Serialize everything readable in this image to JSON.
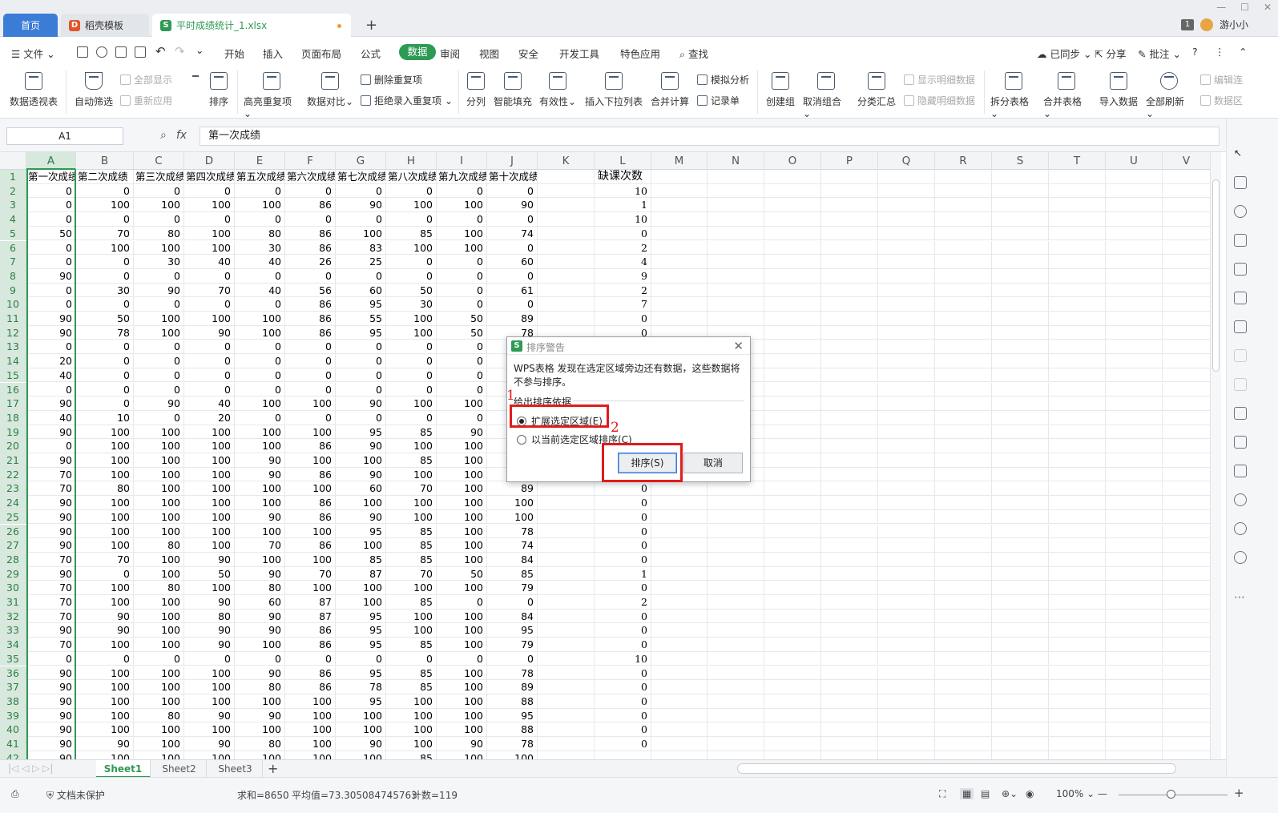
{
  "tabs": {
    "home": "首页",
    "template": "稻壳模板",
    "file": "平时成绩统计_1.xlsx",
    "new": "+"
  },
  "user": {
    "badge": "1",
    "name": "游小小"
  },
  "menu": {
    "file": "文件",
    "items": [
      "开始",
      "插入",
      "页面布局",
      "公式",
      "数据",
      "审阅",
      "视图",
      "安全",
      "开发工具",
      "特色应用"
    ],
    "active": "数据",
    "search": "查找",
    "right": [
      "已同步",
      "分享",
      "批注"
    ]
  },
  "ribbon": {
    "pivot": "数据透视表",
    "autofilter": "自动筛选",
    "show_all": "全部显示",
    "reapply": "重新应用",
    "sort": "排序",
    "highlight_dup": "高亮重复项",
    "compare": "数据对比",
    "delete_dup": "删除重复项",
    "reject_dup": "拒绝录入重复项",
    "split": "分列",
    "smart_fill": "智能填充",
    "validity": "有效性",
    "insert_dropdown": "插入下拉列表",
    "consolidate": "合并计算",
    "simulate": "模拟分析",
    "record": "记录单",
    "create_group": "创建组",
    "ungroup": "取消组合",
    "subtotal": "分类汇总",
    "show_detail": "显示明细数据",
    "hide_detail": "隐藏明细数据",
    "split_table": "拆分表格",
    "merge_table": "合并表格",
    "import": "导入数据",
    "refresh_all": "全部刷新",
    "edit_link": "编辑连",
    "data_area": "数据区"
  },
  "formula_bar": {
    "cell_ref": "A1",
    "fx": "fx",
    "content": "第一次成绩"
  },
  "columns": [
    "A",
    "B",
    "C",
    "D",
    "E",
    "F",
    "G",
    "H",
    "I",
    "J",
    "K",
    "L",
    "M",
    "N",
    "O",
    "P",
    "Q",
    "R",
    "S",
    "T",
    "U",
    "V"
  ],
  "header_row": [
    "第一次成绩",
    "第二次成绩",
    "第三次成绩",
    "第四次成绩",
    "第五次成绩",
    "第六次成绩",
    "第七次成绩",
    "第八次成绩",
    "第九次成绩",
    "第十次成绩",
    "",
    "缺课次数"
  ],
  "rows": [
    [
      0,
      0,
      0,
      0,
      0,
      0,
      0,
      0,
      0,
      0,
      "",
      10
    ],
    [
      0,
      100,
      100,
      100,
      100,
      86,
      90,
      100,
      100,
      90,
      "",
      1
    ],
    [
      0,
      0,
      0,
      0,
      0,
      0,
      0,
      0,
      0,
      0,
      "",
      10
    ],
    [
      50,
      70,
      80,
      100,
      80,
      86,
      100,
      85,
      100,
      74,
      "",
      0
    ],
    [
      0,
      100,
      100,
      100,
      30,
      86,
      83,
      100,
      100,
      0,
      "",
      2
    ],
    [
      0,
      0,
      30,
      40,
      40,
      26,
      25,
      0,
      0,
      60,
      "",
      4
    ],
    [
      90,
      0,
      0,
      0,
      0,
      0,
      0,
      0,
      0,
      0,
      "",
      9
    ],
    [
      0,
      30,
      90,
      70,
      40,
      56,
      60,
      50,
      0,
      61,
      "",
      2
    ],
    [
      0,
      0,
      0,
      0,
      0,
      86,
      95,
      30,
      0,
      0,
      "",
      7
    ],
    [
      90,
      50,
      100,
      100,
      100,
      86,
      55,
      100,
      50,
      89,
      "",
      0
    ],
    [
      90,
      78,
      100,
      90,
      100,
      86,
      95,
      100,
      50,
      78,
      "",
      0
    ],
    [
      0,
      0,
      0,
      0,
      0,
      0,
      0,
      0,
      0,
      "",
      "",
      ""
    ],
    [
      20,
      0,
      0,
      0,
      0,
      0,
      0,
      0,
      0,
      "",
      "",
      ""
    ],
    [
      40,
      0,
      0,
      0,
      0,
      0,
      0,
      0,
      0,
      "",
      "",
      ""
    ],
    [
      0,
      0,
      0,
      0,
      0,
      0,
      0,
      0,
      0,
      "",
      "",
      ""
    ],
    [
      90,
      0,
      90,
      40,
      100,
      100,
      90,
      100,
      100,
      "",
      "",
      ""
    ],
    [
      40,
      10,
      0,
      20,
      0,
      0,
      0,
      0,
      0,
      "",
      "",
      ""
    ],
    [
      90,
      100,
      100,
      100,
      100,
      100,
      95,
      85,
      90,
      "",
      "",
      ""
    ],
    [
      0,
      100,
      100,
      100,
      100,
      86,
      90,
      100,
      100,
      "",
      "",
      ""
    ],
    [
      90,
      100,
      100,
      100,
      90,
      100,
      100,
      85,
      100,
      "",
      "",
      ""
    ],
    [
      70,
      100,
      100,
      100,
      90,
      86,
      90,
      100,
      100,
      "",
      "",
      ""
    ],
    [
      70,
      80,
      100,
      100,
      100,
      100,
      60,
      70,
      100,
      89,
      "",
      0
    ],
    [
      90,
      100,
      100,
      100,
      100,
      86,
      100,
      100,
      100,
      100,
      "",
      0
    ],
    [
      90,
      100,
      100,
      100,
      90,
      86,
      90,
      100,
      100,
      100,
      "",
      0
    ],
    [
      90,
      100,
      100,
      100,
      100,
      100,
      95,
      85,
      100,
      78,
      "",
      0
    ],
    [
      90,
      100,
      80,
      100,
      70,
      86,
      100,
      85,
      100,
      74,
      "",
      0
    ],
    [
      70,
      70,
      100,
      90,
      100,
      100,
      85,
      85,
      100,
      84,
      "",
      0
    ],
    [
      90,
      0,
      100,
      50,
      90,
      70,
      87,
      70,
      50,
      85,
      "",
      1
    ],
    [
      70,
      100,
      80,
      100,
      80,
      100,
      100,
      100,
      100,
      79,
      "",
      0
    ],
    [
      70,
      100,
      100,
      90,
      60,
      87,
      100,
      85,
      0,
      0,
      "",
      2
    ],
    [
      70,
      90,
      100,
      80,
      90,
      87,
      95,
      100,
      100,
      84,
      "",
      0
    ],
    [
      90,
      90,
      100,
      90,
      90,
      86,
      95,
      100,
      100,
      95,
      "",
      0
    ],
    [
      70,
      100,
      100,
      90,
      100,
      86,
      95,
      85,
      100,
      79,
      "",
      0
    ],
    [
      0,
      0,
      0,
      0,
      0,
      0,
      0,
      0,
      0,
      0,
      "",
      10
    ],
    [
      90,
      100,
      100,
      100,
      90,
      86,
      95,
      85,
      100,
      78,
      "",
      0
    ],
    [
      90,
      100,
      100,
      100,
      80,
      86,
      78,
      85,
      100,
      89,
      "",
      0
    ],
    [
      90,
      100,
      100,
      100,
      100,
      100,
      95,
      100,
      100,
      88,
      "",
      0
    ],
    [
      90,
      100,
      80,
      90,
      90,
      100,
      100,
      100,
      100,
      95,
      "",
      0
    ],
    [
      90,
      100,
      100,
      100,
      100,
      100,
      100,
      100,
      100,
      88,
      "",
      0
    ],
    [
      90,
      90,
      100,
      90,
      80,
      100,
      90,
      100,
      90,
      78,
      "",
      0
    ],
    [
      90,
      100,
      100,
      100,
      100,
      100,
      100,
      85,
      100,
      100,
      "",
      ""
    ]
  ],
  "sheets": [
    "Sheet1",
    "Sheet2",
    "Sheet3"
  ],
  "status": {
    "protect": "文档未保护",
    "sum": "求和=8650",
    "avg": "平均值=73.305084745763",
    "count": "计数=119",
    "zoom": "100%"
  },
  "dialog": {
    "title": "排序警告",
    "message": "WPS表格 发现在选定区域旁边还有数据，这些数据将不参与排序。",
    "group_label": "给出排序依据",
    "option_expand": "扩展选定区域(E)",
    "option_current": "以当前选定区域排序(C)",
    "selected_option": "expand",
    "sort_button": "排序(S)",
    "cancel_button": "取消"
  },
  "annotations": {
    "step1": "1",
    "step2": "2"
  },
  "colors": {
    "accent": "#2f9a54",
    "tab_blue": "#3b7cd6",
    "highlight_red": "#e01b1b"
  }
}
